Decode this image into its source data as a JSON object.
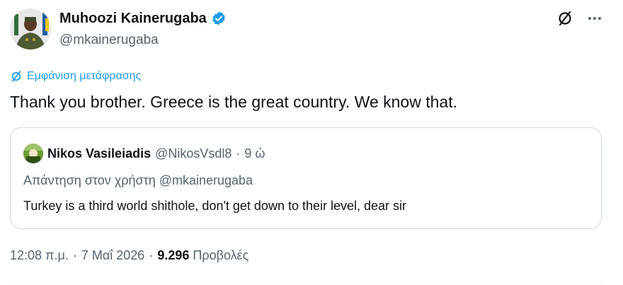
{
  "author": {
    "display_name": "Muhoozi Kainerugaba",
    "handle": "@mkainerugaba",
    "verified": true
  },
  "translate_link": "Εμφάνιση μετάφρασης",
  "tweet_text": "Thank you brother. Greece is the great country. We know that.",
  "quoted": {
    "display_name": "Nikos Vasileiadis",
    "handle": "@NikosVsdl8",
    "separator": "·",
    "time": "9 ώ",
    "reply_to": "Απάντηση στον χρήστη @mkainerugaba",
    "text": "Turkey is a third world shithole, don't get down to their level, dear sir"
  },
  "meta": {
    "time": "12:08 π.μ.",
    "dot1": "·",
    "date": "7 Μαΐ 2026",
    "dot2": "·",
    "views_count": "9.296",
    "views_label": "Προβολές"
  },
  "icons": {
    "verified": "verified-badge-icon",
    "translate": "translate-icon",
    "more": "more-icon"
  },
  "colors": {
    "link": "#1d9bf0",
    "secondary_text": "#536471",
    "primary_text": "#0f1419",
    "border": "#cfd9de"
  }
}
